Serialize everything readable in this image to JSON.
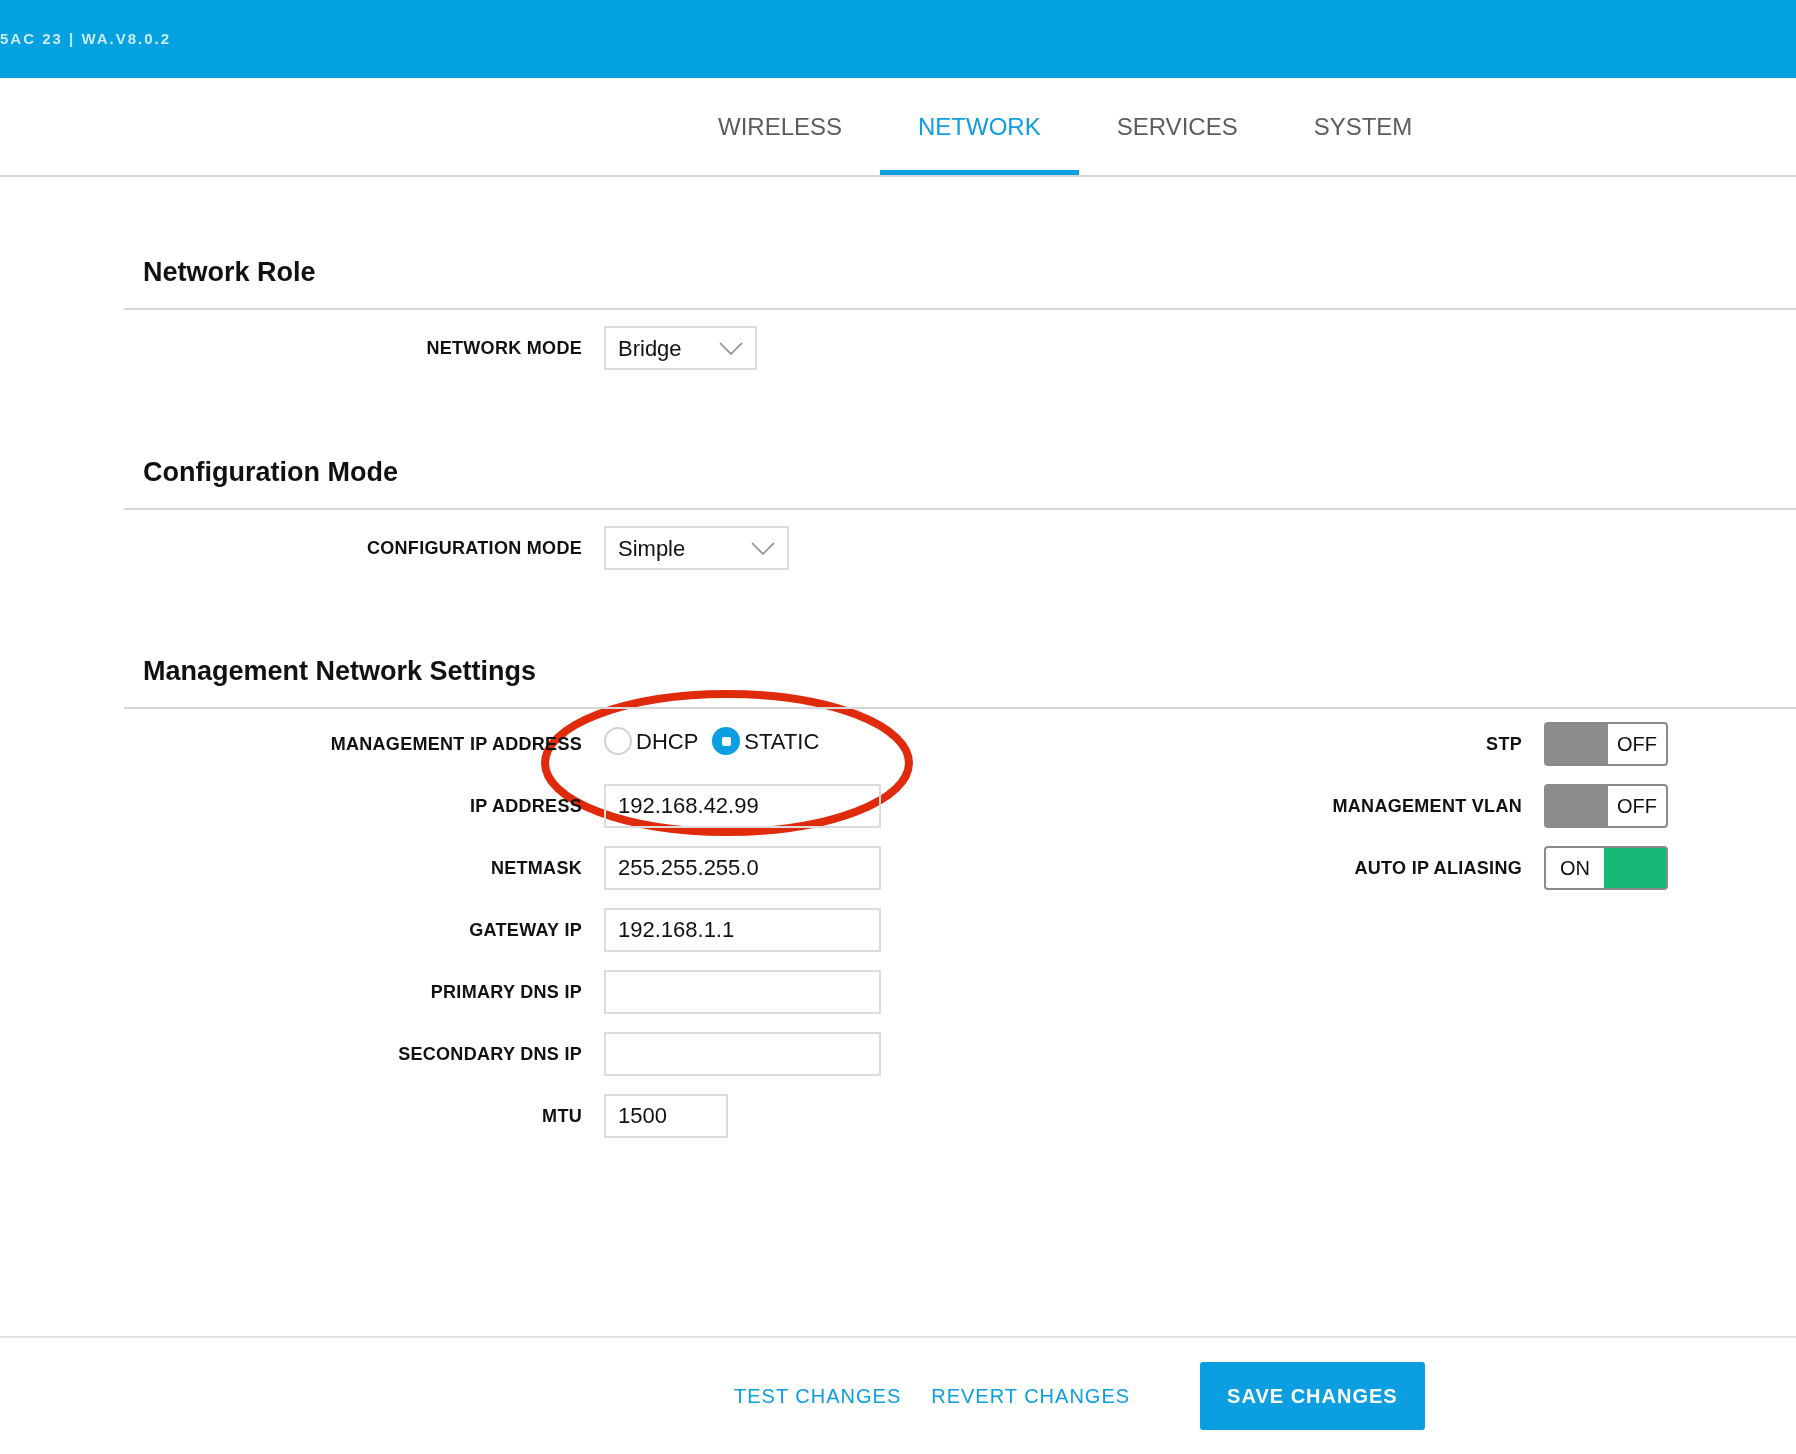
{
  "header": {
    "device": "5AC 23 | WA.V8.0.2"
  },
  "tabs": [
    {
      "label": "WIRELESS",
      "selected": false
    },
    {
      "label": "NETWORK",
      "selected": true
    },
    {
      "label": "SERVICES",
      "selected": false
    },
    {
      "label": "SYSTEM",
      "selected": false
    }
  ],
  "sections": [
    {
      "title": "Network Role",
      "rows": [
        {
          "kind": "select",
          "label": "NETWORK MODE",
          "value": "Bridge"
        }
      ]
    },
    {
      "title": "Configuration Mode",
      "rows": [
        {
          "kind": "select",
          "label": "CONFIGURATION MODE",
          "value": "Simple"
        }
      ]
    },
    {
      "title": "Management Network Settings",
      "rows": [
        {
          "kind": "radio",
          "label": "MANAGEMENT IP ADDRESS",
          "options": [
            {
              "label": "DHCP",
              "selected": false
            },
            {
              "label": "STATIC",
              "selected": true
            }
          ]
        },
        {
          "kind": "input",
          "label": "IP ADDRESS",
          "value": "192.168.42.99"
        },
        {
          "kind": "input",
          "label": "NETMASK",
          "value": "255.255.255.0"
        },
        {
          "kind": "input",
          "label": "GATEWAY IP",
          "value": "192.168.1.1"
        },
        {
          "kind": "input",
          "label": "PRIMARY DNS IP"
        },
        {
          "kind": "input",
          "label": "SECONDARY DNS IP"
        },
        {
          "kind": "short-input",
          "label": "MTU",
          "value": "1500"
        }
      ],
      "toggles": [
        {
          "label": "STP",
          "on": false,
          "text": "OFF"
        },
        {
          "label": "MANAGEMENT VLAN",
          "on": false,
          "text": "OFF"
        },
        {
          "label": "AUTO IP ALIASING",
          "on": true,
          "text": "ON"
        }
      ]
    }
  ],
  "footer": {
    "buttons": [
      {
        "label": "TEST CHANGES",
        "kind": "link"
      },
      {
        "label": "REVERT CHANGES",
        "kind": "link"
      },
      {
        "label": "SAVE CHANGES",
        "kind": "primary"
      }
    ]
  }
}
